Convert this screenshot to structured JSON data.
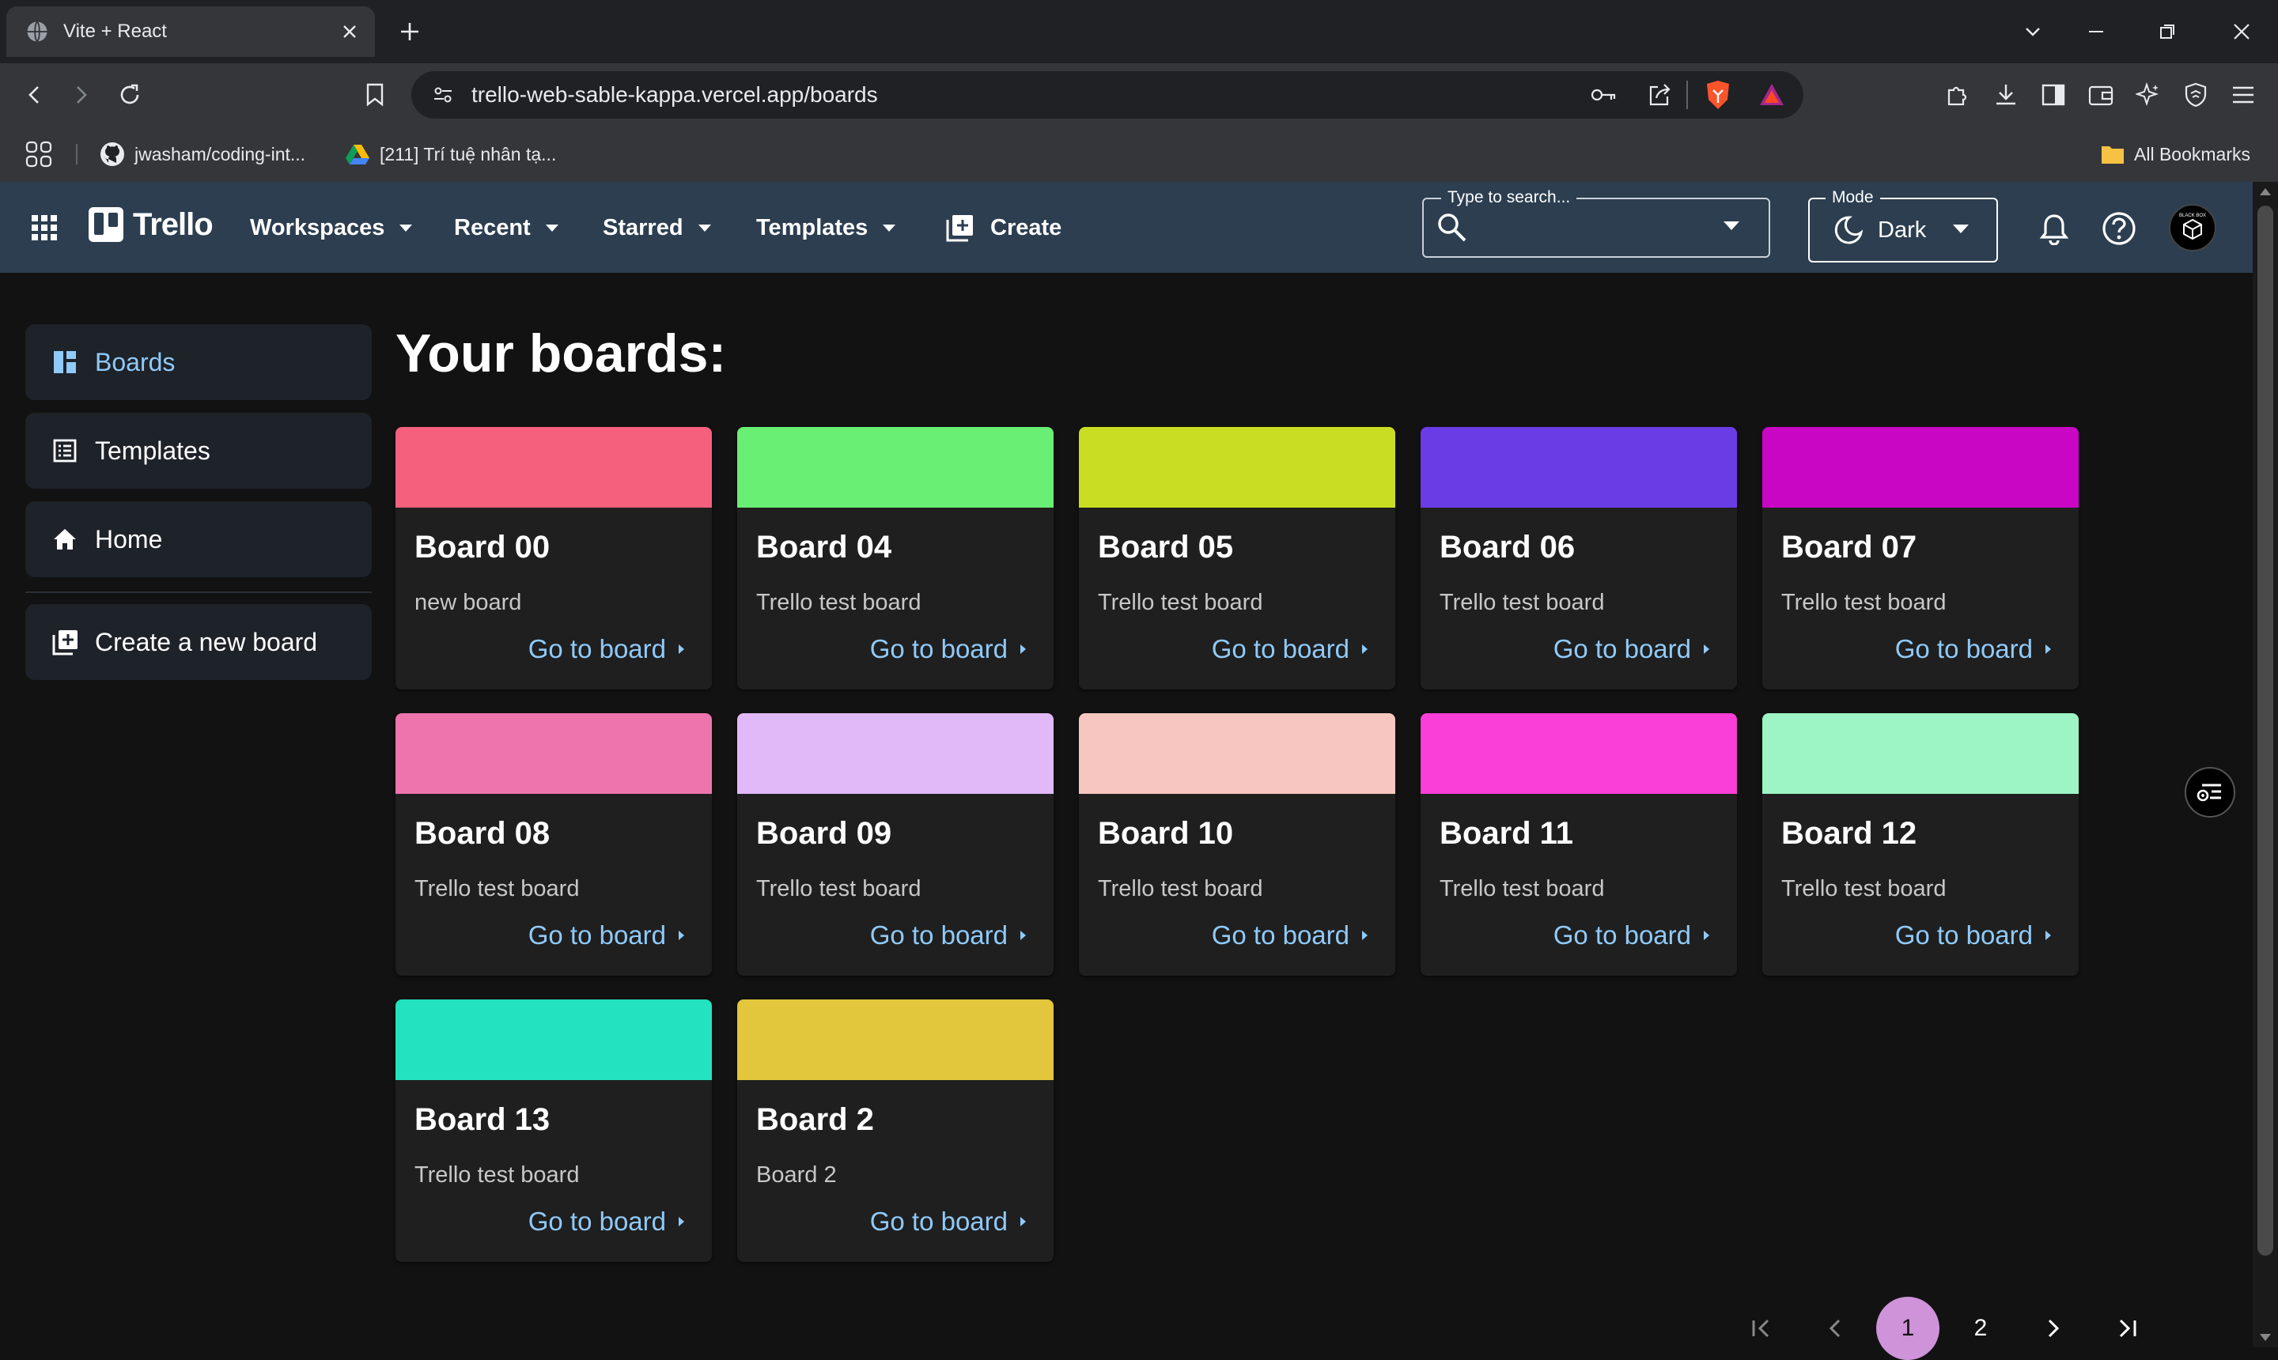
{
  "browser": {
    "tab_title": "Vite + React",
    "url": "trello-web-sable-kappa.vercel.app/boards",
    "bookmarks": [
      {
        "label": "jwasham/coding-int...",
        "icon": "github-icon"
      },
      {
        "label": "[211] Trí tuệ nhân tạ...",
        "icon": "google-drive-icon"
      }
    ],
    "all_bookmarks_label": "All Bookmarks"
  },
  "header": {
    "logo_text": "Trello",
    "nav": {
      "workspaces": "Workspaces",
      "recent": "Recent",
      "starred": "Starred",
      "templates": "Templates",
      "create": "Create"
    },
    "search": {
      "legend": "Type to search...",
      "value": ""
    },
    "mode": {
      "legend": "Mode",
      "value": "Dark"
    },
    "avatar_text": "BLACK BOX"
  },
  "sidebar": {
    "items": [
      {
        "label": "Boards",
        "icon": "dashboard-icon",
        "active": true
      },
      {
        "label": "Templates",
        "icon": "list-alt-icon",
        "active": false
      },
      {
        "label": "Home",
        "icon": "home-icon",
        "active": false
      },
      {
        "label": "Create a new board",
        "icon": "library-add-icon",
        "active": false
      }
    ]
  },
  "main": {
    "heading": "Your boards:",
    "boards": [
      {
        "title": "Board 00",
        "description": "new board",
        "cover": "#f5607c",
        "link": "Go to board"
      },
      {
        "title": "Board 04",
        "description": "Trello test board",
        "cover": "#68ef74",
        "link": "Go to board"
      },
      {
        "title": "Board 05",
        "description": "Trello test board",
        "cover": "#c9de22",
        "link": "Go to board"
      },
      {
        "title": "Board 06",
        "description": "Trello test board",
        "cover": "#6a3ce6",
        "link": "Go to board"
      },
      {
        "title": "Board 07",
        "description": "Trello test board",
        "cover": "#c806c4",
        "link": "Go to board"
      },
      {
        "title": "Board 08",
        "description": "Trello test board",
        "cover": "#ee74ad",
        "link": "Go to board"
      },
      {
        "title": "Board 09",
        "description": "Trello test board",
        "cover": "#e1b8f8",
        "link": "Go to board"
      },
      {
        "title": "Board 10",
        "description": "Trello test board",
        "cover": "#f8c6c0",
        "link": "Go to board"
      },
      {
        "title": "Board 11",
        "description": "Trello test board",
        "cover": "#fa3ed8",
        "link": "Go to board"
      },
      {
        "title": "Board 12",
        "description": "Trello test board",
        "cover": "#9df4c4",
        "link": "Go to board"
      },
      {
        "title": "Board 13",
        "description": "Trello test board",
        "cover": "#22e2c0",
        "link": "Go to board"
      },
      {
        "title": "Board 2",
        "description": "Board 2",
        "cover": "#e2c63b",
        "link": "Go to board"
      }
    ]
  },
  "pagination": {
    "pages": [
      "1",
      "2"
    ],
    "current": "1"
  },
  "colors": {
    "app_bar": "#2c3e50",
    "background": "#121212",
    "card": "#1f1f1f",
    "link": "#90caf9",
    "current_page": "#ce93d8"
  }
}
